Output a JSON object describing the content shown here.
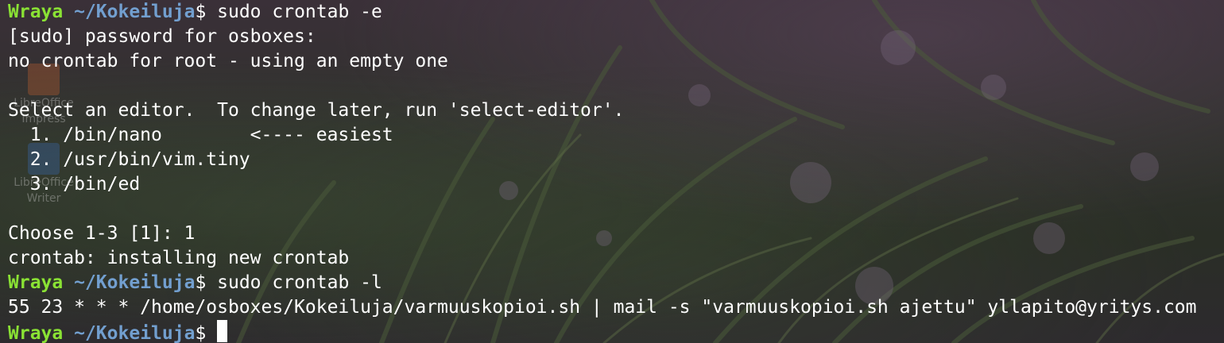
{
  "colors": {
    "prompt_user": "#8ae234",
    "prompt_path": "#729fcf",
    "text": "#ffffff"
  },
  "desktop_icons": [
    {
      "icon": "libreoffice-impress-icon",
      "label_line1": "LibreOffice",
      "label_line2": "Impress"
    },
    {
      "icon": "libreoffice-writer-icon",
      "label_line1": "LibreOffice",
      "label_line2": "Writer"
    }
  ],
  "terminal": {
    "prompt": {
      "user": "Wraya",
      "path": "~/Kokeiluja",
      "symbol": "$"
    },
    "lines": [
      {
        "type": "prompt",
        "command": " sudo crontab -e"
      },
      {
        "type": "output",
        "text": "[sudo] password for osboxes:"
      },
      {
        "type": "output",
        "text": "no crontab for root - using an empty one"
      },
      {
        "type": "output",
        "text": ""
      },
      {
        "type": "output",
        "text": "Select an editor.  To change later, run 'select-editor'."
      },
      {
        "type": "output",
        "text": "  1. /bin/nano        <---- easiest"
      },
      {
        "type": "output",
        "text": "  2. /usr/bin/vim.tiny"
      },
      {
        "type": "output",
        "text": "  3. /bin/ed"
      },
      {
        "type": "output",
        "text": ""
      },
      {
        "type": "output",
        "text": "Choose 1-3 [1]: 1"
      },
      {
        "type": "output",
        "text": "crontab: installing new crontab"
      },
      {
        "type": "prompt",
        "command": " sudo crontab -l"
      },
      {
        "type": "output",
        "text": "55 23 * * * /home/osboxes/Kokeiluja/varmuuskopioi.sh | mail -s \"varmuuskopioi.sh ajettu\" yllapito@yritys.com"
      },
      {
        "type": "prompt",
        "command": " "
      }
    ]
  }
}
